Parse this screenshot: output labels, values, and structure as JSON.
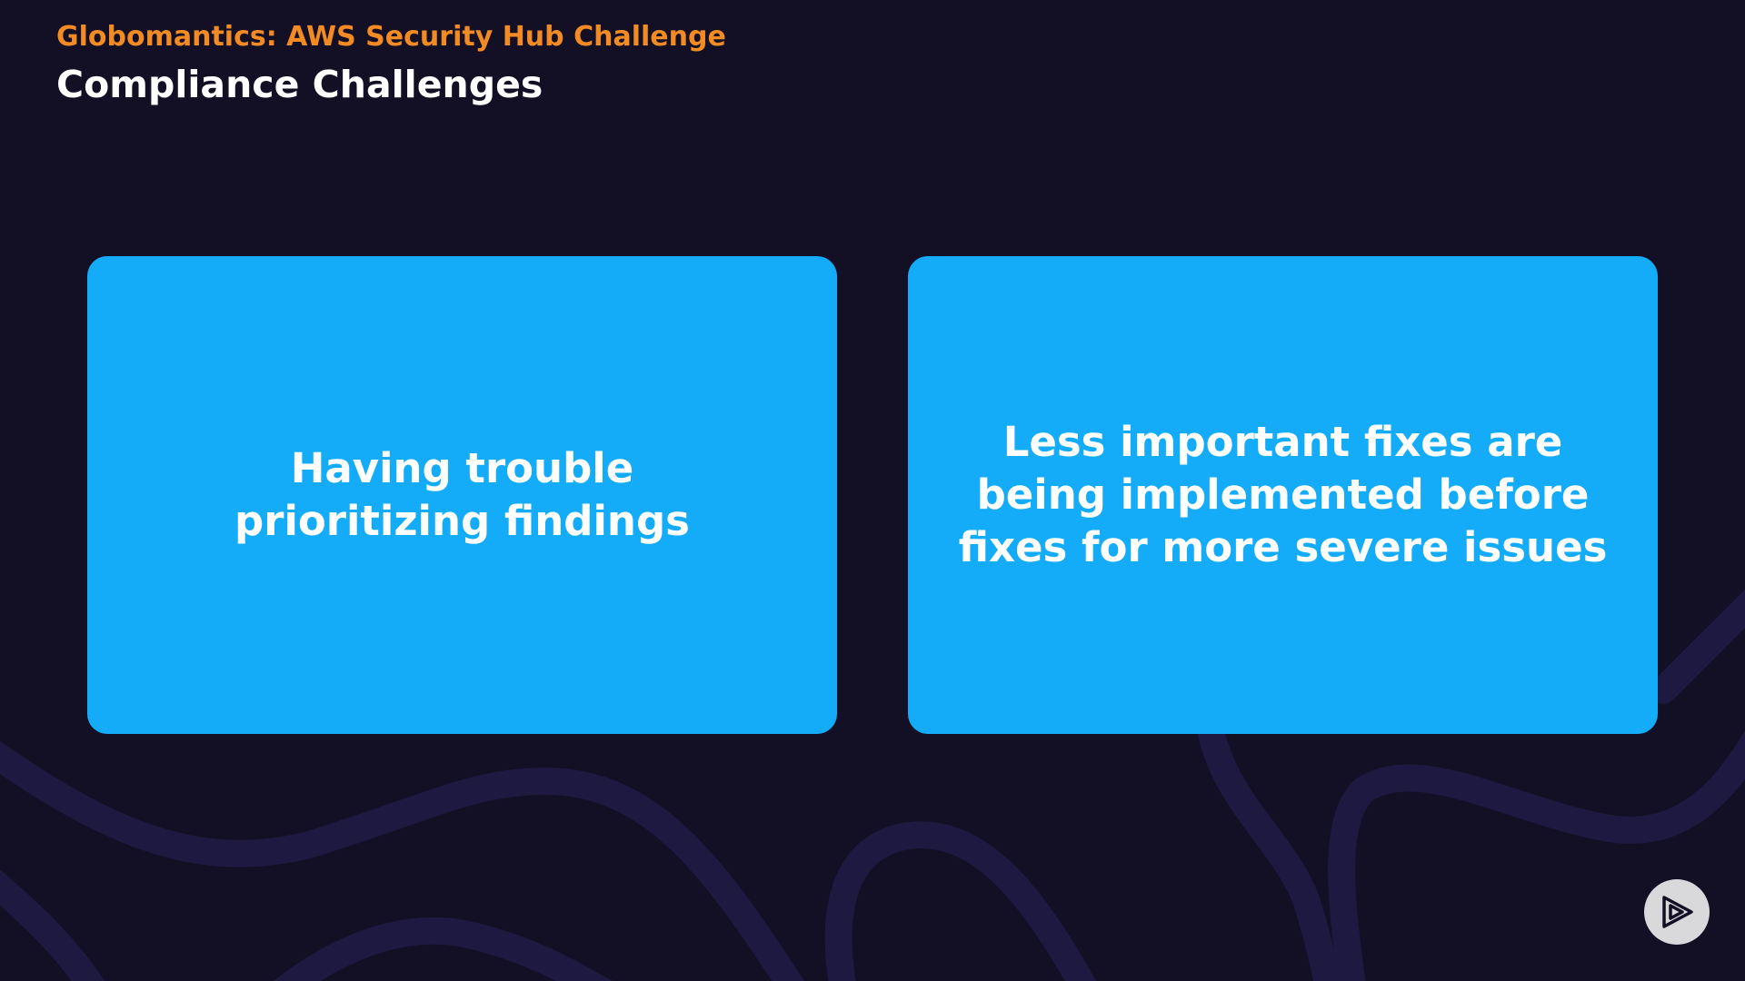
{
  "header": {
    "course_title": "Globomantics: AWS Security Hub Challenge",
    "page_title": "Compliance Challenges"
  },
  "cards": [
    {
      "text": "Having trouble prioritizing findings"
    },
    {
      "text": "Less important fixes are being implemented before fixes for more severe issues"
    }
  ],
  "colors": {
    "background": "#130f25",
    "accent": "#f38b24",
    "card": "#14acf9",
    "decor": "#1d1940"
  },
  "icons": {
    "play_button": "play-logo-icon"
  }
}
